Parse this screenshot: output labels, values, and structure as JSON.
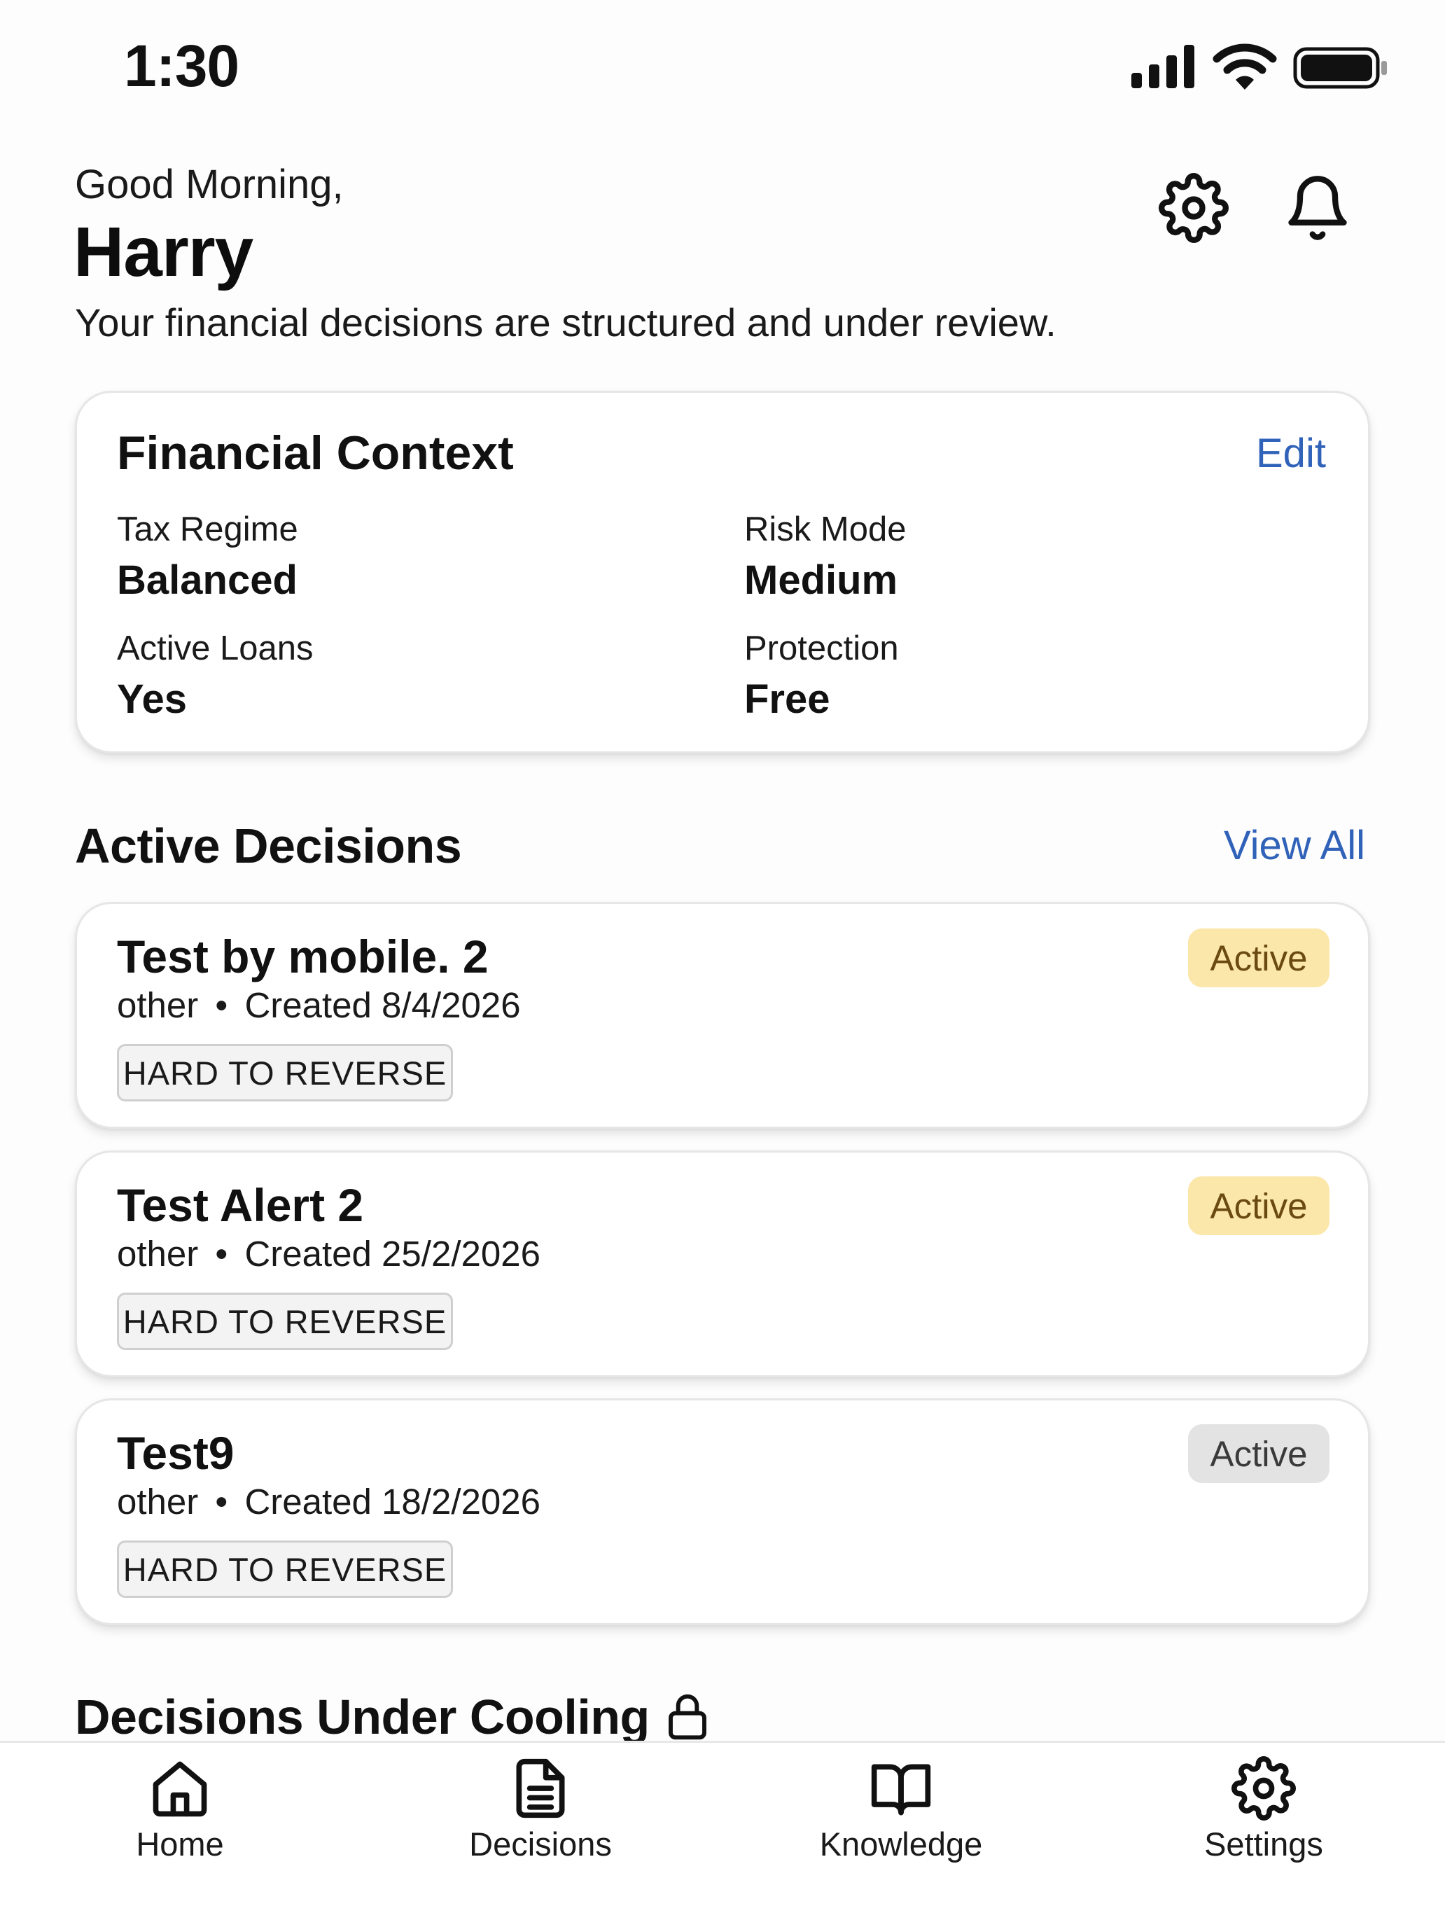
{
  "status_bar": {
    "time": "1:30",
    "icons": [
      "cellular-signal-icon",
      "wifi-icon",
      "battery-icon"
    ]
  },
  "header": {
    "greeting": "Good Morning,",
    "name": "Harry",
    "subtitle": "Your financial decisions are structured and under review.",
    "actions": [
      "gear-icon",
      "bell-icon"
    ]
  },
  "financial_context": {
    "title": "Financial Context",
    "edit_label": "Edit",
    "fields": [
      {
        "label": "Tax Regime",
        "value": "Balanced"
      },
      {
        "label": "Risk Mode",
        "value": "Medium"
      },
      {
        "label": "Active Loans",
        "value": "Yes"
      },
      {
        "label": "Protection",
        "value": "Free"
      }
    ]
  },
  "active_decisions": {
    "title": "Active Decisions",
    "view_all_label": "View All",
    "items": [
      {
        "title": "Test by mobile. 2",
        "category": "other",
        "created": "Created 8/4/2026",
        "tag": "HARD TO REVERSE",
        "status": "Active",
        "status_color": "#fbe7a9"
      },
      {
        "title": "Test Alert 2",
        "category": "other",
        "created": "Created 25/2/2026",
        "tag": "HARD TO REVERSE",
        "status": "Active",
        "status_color": "#fbe7a9"
      },
      {
        "title": "Test9",
        "category": "other",
        "created": "Created 18/2/2026",
        "tag": "HARD TO REVERSE",
        "status": "Active",
        "status_color": "#e3e3e3"
      }
    ],
    "separator": "•"
  },
  "cooling_section": {
    "title": "Decisions Under Cooling",
    "icon": "lock-icon"
  },
  "bottom_nav": {
    "items": [
      {
        "label": "Home",
        "icon": "home-icon"
      },
      {
        "label": "Decisions",
        "icon": "document-icon"
      },
      {
        "label": "Knowledge",
        "icon": "book-icon"
      },
      {
        "label": "Settings",
        "icon": "gear-icon"
      }
    ]
  },
  "colors": {
    "link": "#2f62b8",
    "active_amber": "#fbe7a9",
    "active_amber_text": "#6a4a10",
    "active_gray": "#e3e3e3",
    "active_gray_text": "#3a3a3a"
  }
}
